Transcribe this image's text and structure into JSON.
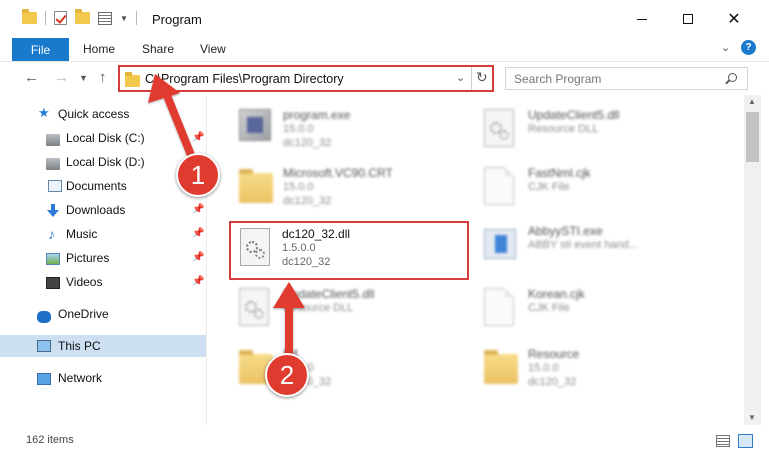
{
  "window": {
    "title": "Program",
    "controls": {
      "minimize": "",
      "maximize": "",
      "close": "✕"
    }
  },
  "ribbon": {
    "tabs": [
      {
        "label": "File",
        "active": true
      },
      {
        "label": "Home"
      },
      {
        "label": "Share"
      },
      {
        "label": "View"
      }
    ],
    "help": "?"
  },
  "address": {
    "path": "C:\\Program Files\\Program Directory",
    "search_placeholder": "Search Program"
  },
  "sidebar": {
    "items": [
      {
        "label": "Quick access",
        "icon": "star-icon",
        "pinned": false
      },
      {
        "label": "Local Disk (C:)",
        "icon": "drive-icon",
        "pinned": true
      },
      {
        "label": "Local Disk (D:)",
        "icon": "drive-icon",
        "pinned": false
      },
      {
        "label": "Documents",
        "icon": "documents-icon",
        "pinned": true
      },
      {
        "label": "Downloads",
        "icon": "download-icon",
        "pinned": true
      },
      {
        "label": "Music",
        "icon": "music-icon",
        "pinned": true
      },
      {
        "label": "Pictures",
        "icon": "pictures-icon",
        "pinned": true
      },
      {
        "label": "Videos",
        "icon": "videos-icon",
        "pinned": true
      },
      {
        "label": "OneDrive",
        "icon": "cloud-icon",
        "pinned": false
      },
      {
        "label": "This PC",
        "icon": "computer-icon",
        "pinned": false,
        "selected": true
      },
      {
        "label": "Network",
        "icon": "network-icon",
        "pinned": false
      }
    ],
    "pin_glyph": "📌"
  },
  "files": [
    {
      "name": "program.exe",
      "line1": "15.0.0",
      "line2": "dc120_32",
      "icon": "exe-icon"
    },
    {
      "name": "UpdateClient5.dll",
      "line1": "Resource DLL",
      "line2": "",
      "icon": "dll-icon"
    },
    {
      "name": "Microsoft.VC90.CRT",
      "line1": "15.0.0",
      "line2": "dc120_32",
      "icon": "folder-icon"
    },
    {
      "name": "FastNml.cjk",
      "line1": "CJK File",
      "line2": "",
      "icon": "file-icon"
    },
    {
      "name": "dc120_32.dll",
      "line1": "1.5.0.0",
      "line2": "dc120_32",
      "icon": "dll-icon",
      "highlighted": true
    },
    {
      "name": "AbbyySTI.exe",
      "line1": "ABBY sti event hand...",
      "line2": "",
      "icon": "app-icon"
    },
    {
      "name": "UpdateClient5.dll",
      "line1": "Resource DLL",
      "line2": "",
      "icon": "dll-icon"
    },
    {
      "name": "Korean.cjk",
      "line1": "CJK File",
      "line2": "",
      "icon": "file-icon"
    },
    {
      "name": "R4",
      "line1": "15.0.0",
      "line2": "dc120_32",
      "icon": "folder-icon"
    },
    {
      "name": "Resource",
      "line1": "15.0.0",
      "line2": "dc120_32",
      "icon": "folder-icon"
    }
  ],
  "status": {
    "item_count": "162 items"
  },
  "annotations": {
    "step1": "1",
    "step2": "2",
    "color": "#e03b2f"
  }
}
